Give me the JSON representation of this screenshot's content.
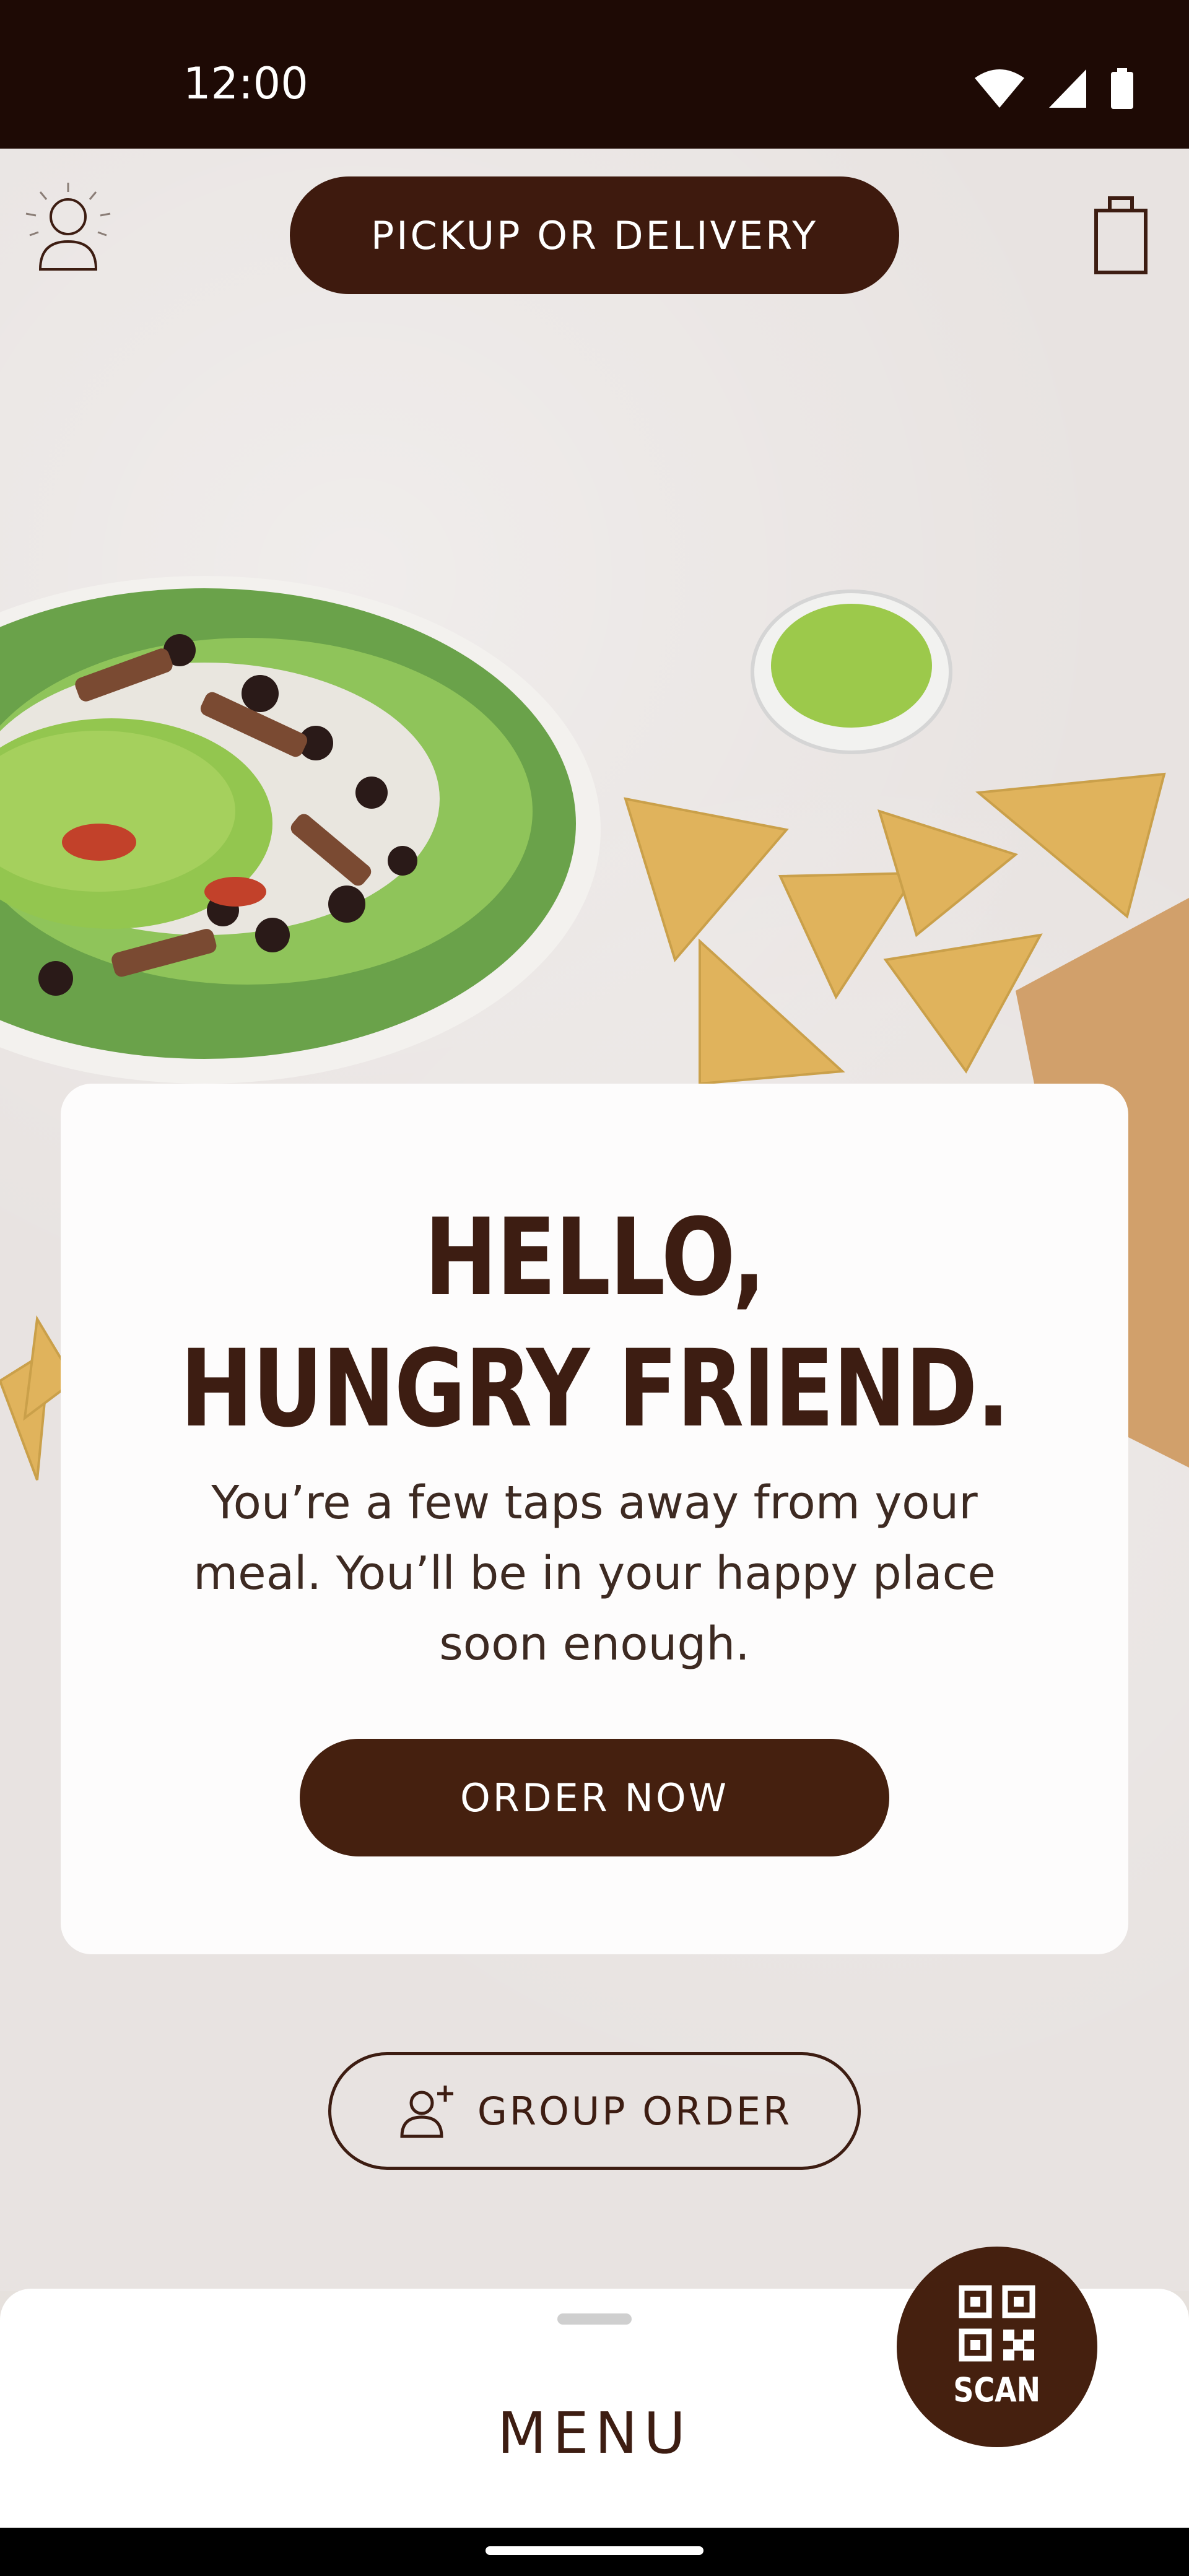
{
  "status_bar": {
    "time": "12:00"
  },
  "top_nav": {
    "pickup_label": "PICKUP OR DELIVERY"
  },
  "hero": {
    "title_line1": "HELLO,",
    "title_line2": "HUNGRY FRIEND.",
    "subtitle": "You’re a few taps away from your meal. You’ll be in your happy place soon enough.",
    "order_label": "ORDER NOW"
  },
  "group_order": {
    "label": "GROUP ORDER"
  },
  "bottom_sheet": {
    "menu_label": "MENU"
  },
  "scan": {
    "label": "SCAN"
  },
  "icons": [
    "profile-icon",
    "bag-icon",
    "wifi-icon",
    "signal-icon",
    "battery-icon",
    "add-person-icon",
    "qr-code-icon"
  ],
  "colors": {
    "brand_dark": "#45200f",
    "status_bar": "#1e0a05",
    "text_dark": "#3d1d12"
  }
}
